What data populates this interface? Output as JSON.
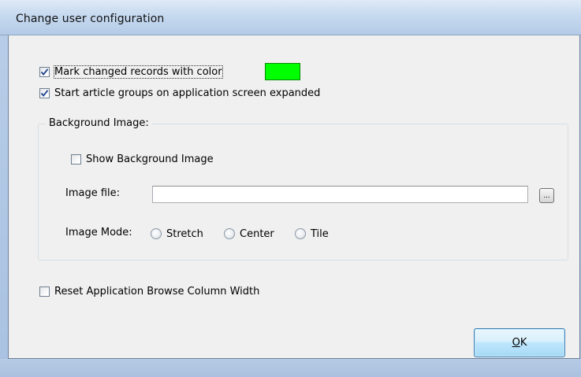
{
  "window": {
    "title": "Change user configuration"
  },
  "options": {
    "mark_changed": {
      "label": "Mark changed records with color",
      "checked": true,
      "color": "#00ff00"
    },
    "expand_groups": {
      "label": "Start article groups on application screen expanded",
      "checked": true
    },
    "reset_width": {
      "label": "Reset Application Browse Column Width",
      "checked": false
    }
  },
  "background_image": {
    "group_label": "Background Image:",
    "show": {
      "label": "Show Background Image",
      "checked": false
    },
    "file_label": "Image file:",
    "file_value": "",
    "browse_label": "...",
    "mode_label": "Image Mode:",
    "modes": [
      {
        "label": "Stretch",
        "selected": false
      },
      {
        "label": "Center",
        "selected": false
      },
      {
        "label": "Tile",
        "selected": false
      }
    ]
  },
  "buttons": {
    "ok_accel": "O",
    "ok_rest": "K"
  }
}
